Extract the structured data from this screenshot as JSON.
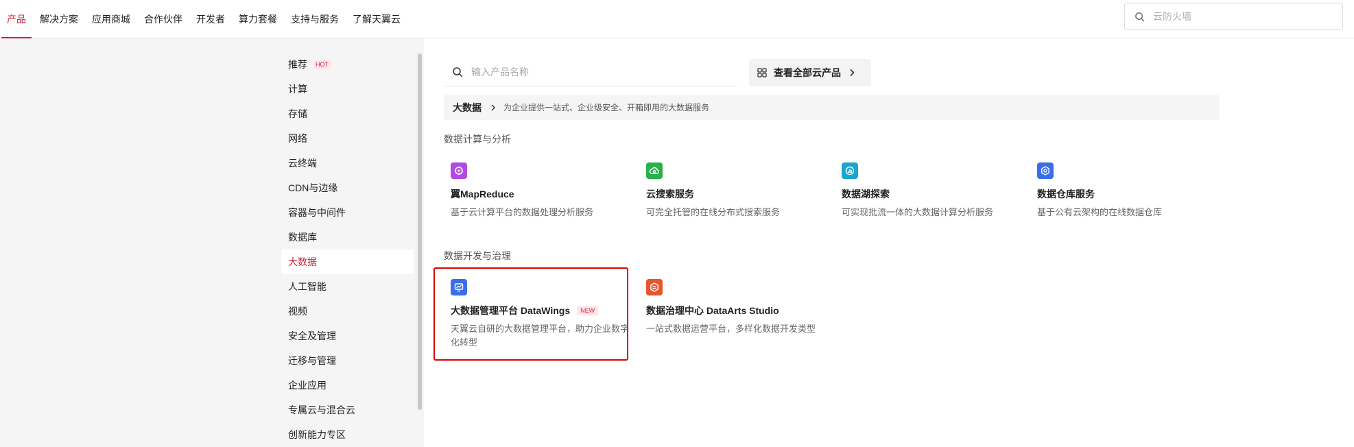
{
  "topnav": {
    "items": [
      "产品",
      "解决方案",
      "应用商城",
      "合作伙伴",
      "开发者",
      "算力套餐",
      "支持与服务",
      "了解天翼云"
    ],
    "active_index": 0,
    "search_placeholder": "云防火墙"
  },
  "sidebar": {
    "items": [
      "推荐",
      "计算",
      "存储",
      "网络",
      "云终端",
      "CDN与边缘",
      "容器与中间件",
      "数据库",
      "大数据",
      "人工智能",
      "视频",
      "安全及管理",
      "迁移与管理",
      "企业应用",
      "专属云与混合云",
      "创新能力专区"
    ],
    "hot_badge": "HOT",
    "active_item": "大数据"
  },
  "main": {
    "search_placeholder": "输入产品名称",
    "all_products_label": "查看全部云产品",
    "breadcrumb": {
      "title": "大数据",
      "description": "为企业提供一站式、企业级安全、开箱即用的大数据服务"
    },
    "sections": [
      {
        "title": "数据计算与分析",
        "products": [
          {
            "name": "翼MapReduce",
            "desc": "基于云计算平台的数据处理分析服务",
            "icon": "mapreduce-icon",
            "color": "#b14be0"
          },
          {
            "name": "云搜索服务",
            "desc": "可完全托管的在线分布式搜索服务",
            "icon": "cloud-search-icon",
            "color": "#27b14a"
          },
          {
            "name": "数据湖探索",
            "desc": "可实现批流一体的大数据计算分析服务",
            "icon": "data-lake-icon",
            "color": "#1aa6c9"
          },
          {
            "name": "数据仓库服务",
            "desc": "基于公有云架构的在线数据仓库",
            "icon": "data-warehouse-icon",
            "color": "#3a6ee8"
          }
        ]
      },
      {
        "title": "数据开发与治理",
        "products": [
          {
            "name": "大数据管理平台 DataWings",
            "badge": "NEW",
            "desc": "天翼云自研的大数据管理平台，助力企业数字化转型",
            "icon": "datawings-icon",
            "color": "#3a6ee8"
          },
          {
            "name": "数据治理中心 DataArts Studio",
            "desc": "一站式数据运营平台，多样化数据开发类型",
            "icon": "dataarts-icon",
            "color": "#e8552f"
          }
        ]
      }
    ]
  },
  "colors": {
    "accent": "#d3203b",
    "highlight": "#e00000"
  }
}
